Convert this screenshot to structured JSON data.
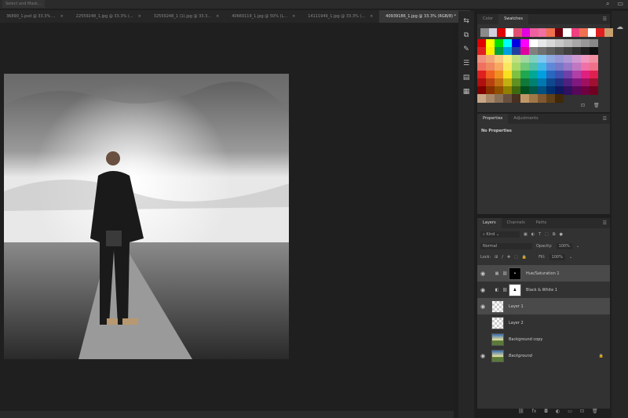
{
  "topbar": {
    "select_mask": "Select and Mask..."
  },
  "tabs": [
    {
      "label": "36890_1.psd @ 33.3% ...",
      "close": "×"
    },
    {
      "label": "22559248_1.jpg @ 33.3% (...",
      "close": "×"
    },
    {
      "label": "32559248_1 (1).jpg @ 33.3...",
      "close": "×"
    },
    {
      "label": "40660119_1.jpg @ 50% (L...",
      "close": "×"
    },
    {
      "label": "14111949_1.jpg @ 33.3% (...",
      "close": "×"
    },
    {
      "label": "40939186_1.jpg @ 33.3% (RGB/8) *",
      "close": "×"
    }
  ],
  "swatches_panel": {
    "tabs": [
      "Color",
      "Swatches"
    ],
    "active": 1,
    "recent": [
      "#8a8a8a",
      "#d0d0e0",
      "#e00000",
      "#ffffff",
      "#e05070",
      "#e000e0",
      "#f060a0",
      "#f070a0",
      "#f07050",
      "#700010",
      "#ffffff",
      "#f04080",
      "#f07050",
      "#ffffff",
      "#e02020",
      "#c8a070"
    ],
    "rows": [
      [
        "#e00000",
        "#ffff00",
        "#00e000",
        "#00ffff",
        "#0000e0",
        "#ff00ff",
        "#ffffff",
        "#e8e8e8",
        "#d8d8d8",
        "#c8c8c8",
        "#b8b8b8",
        "#a8a8a8",
        "#989898",
        "#888888"
      ],
      [
        "#e02020",
        "#ffee00",
        "#00a040",
        "#00a0e0",
        "#2040a0",
        "#e000a0",
        "#808080",
        "#707070",
        "#606060",
        "#505050",
        "#404040",
        "#303030",
        "#202020",
        "#101010"
      ],
      [
        "#f09080",
        "#f0a878",
        "#f8c880",
        "#f8f080",
        "#c0e080",
        "#a0d8a0",
        "#80d0c0",
        "#80c8f0",
        "#90a8e0",
        "#9898d8",
        "#b098d8",
        "#d098d0",
        "#f098c0",
        "#f090a0"
      ],
      [
        "#f07060",
        "#f08860",
        "#f8a860",
        "#f8e860",
        "#a8d868",
        "#70c878",
        "#50c0a8",
        "#40b8e8",
        "#6088d8",
        "#7878c8",
        "#9878c8",
        "#c078c0",
        "#f070a8",
        "#f07088"
      ],
      [
        "#e02020",
        "#f06020",
        "#f09020",
        "#f8e020",
        "#80c040",
        "#20a850",
        "#00a898",
        "#00a0e0",
        "#2868c0",
        "#4050b0",
        "#7040a8",
        "#b040a8",
        "#e02080",
        "#e02050"
      ],
      [
        "#b01010",
        "#b84010",
        "#c07010",
        "#c0b010",
        "#609020",
        "#107838",
        "#008070",
        "#0078b0",
        "#104890",
        "#203080",
        "#502080",
        "#801880",
        "#a01060",
        "#a01030"
      ],
      [
        "#800000",
        "#883000",
        "#905000",
        "#908000",
        "#406810",
        "#005020",
        "#005848",
        "#005080",
        "#003070",
        "#101860",
        "#301060",
        "#580858",
        "#700040",
        "#700020"
      ],
      [
        "#c8a888",
        "#a88868",
        "#887058",
        "#685040",
        "#483020",
        "#c09868",
        "#a07848",
        "#805830",
        "#604018",
        "#402808"
      ]
    ],
    "icons": [
      "new-swatch-icon",
      "delete-icon"
    ]
  },
  "properties_panel": {
    "tabs": [
      "Properties",
      "Adjustments"
    ],
    "active": 0,
    "message": "No Properties"
  },
  "layers_panel": {
    "tabs": [
      "Layers",
      "Channels",
      "Paths"
    ],
    "active": 0,
    "filter_label": "Kind",
    "blend_mode": "Normal",
    "opacity_label": "Opacity:",
    "opacity": "100%",
    "lock_label": "Lock:",
    "fill_label": "Fill:",
    "fill": "100%",
    "layers": [
      {
        "name": "Hue/Saturation 1",
        "visible": true,
        "selected": true,
        "type": "adjustment-hue"
      },
      {
        "name": "Black & White 1",
        "visible": true,
        "selected": false,
        "type": "adjustment-bw"
      },
      {
        "name": "Layer 1",
        "visible": true,
        "selected": true,
        "type": "pixel-person"
      },
      {
        "name": "Layer 2",
        "visible": false,
        "selected": false,
        "type": "pixel-empty"
      },
      {
        "name": "Background copy",
        "visible": false,
        "selected": false,
        "type": "pixel-bg"
      },
      {
        "name": "Background",
        "visible": true,
        "selected": false,
        "type": "background",
        "locked": true
      }
    ]
  }
}
